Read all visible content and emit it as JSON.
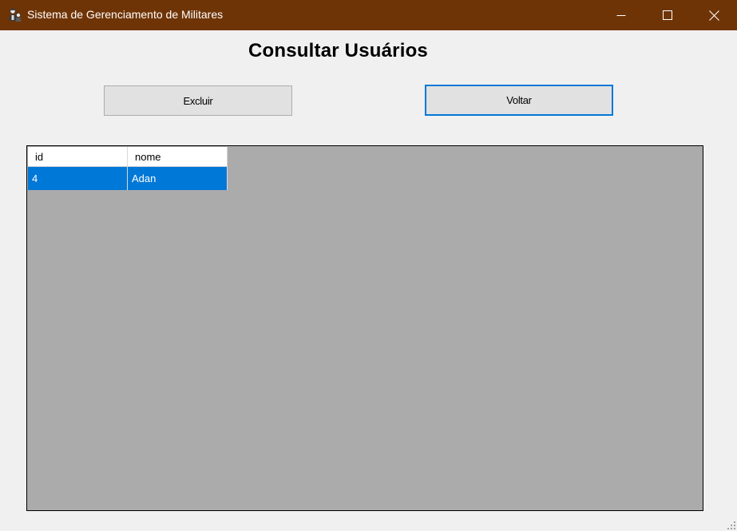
{
  "window": {
    "title": "Sistema de Gerenciamento de Militares",
    "icon": "militar-app-icon",
    "controls": [
      "minimize-icon",
      "maximize-icon",
      "close-icon"
    ]
  },
  "page": {
    "title": "Consultar Usuários"
  },
  "buttons": {
    "excluir": "Excluir",
    "voltar": "Voltar"
  },
  "table": {
    "columns": [
      "id",
      "nome"
    ],
    "rows": [
      {
        "id": "4",
        "nome": "Adan",
        "selected": true
      }
    ]
  },
  "colors": {
    "titlebar": "#6f3406",
    "selection": "#0078d7",
    "grid_background": "#ababab",
    "form_background": "#f0f0f0"
  }
}
